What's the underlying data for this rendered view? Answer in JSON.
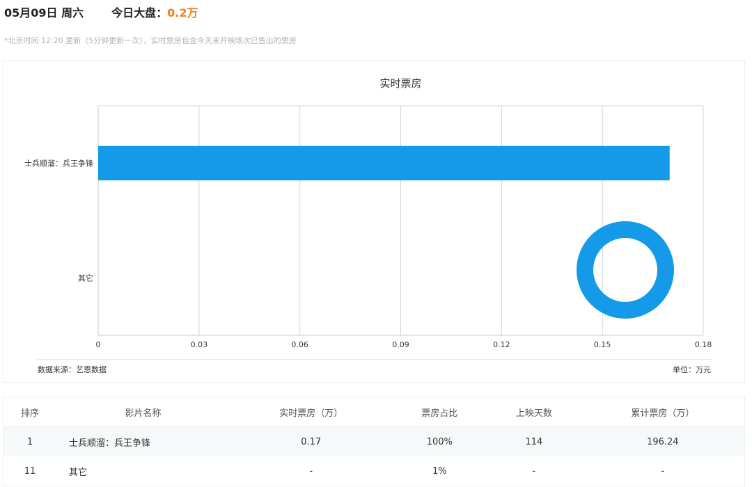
{
  "header": {
    "date": "05月09日 周六",
    "kpi_label": "今日大盘：",
    "kpi_value": "0.2万"
  },
  "note": "*北京时间 12:20 更新（5分钟更新一次），实时票房包含今天未开映场次已售出的票房",
  "chart_data": {
    "type": "bar",
    "orientation": "horizontal",
    "title": "实时票房",
    "categories": [
      "士兵顺溜：兵王争锋",
      "其它"
    ],
    "values": [
      0.17,
      0
    ],
    "xlim": [
      0,
      0.18
    ],
    "x_ticks": [
      "0",
      "0.03",
      "0.06",
      "0.09",
      "0.12",
      "0.15",
      "0.18"
    ],
    "grid": true,
    "bar_color": "#149ae9"
  },
  "footer": {
    "source": "数据来源：艺恩数据",
    "unit": "单位：万元"
  },
  "table": {
    "headers": [
      "排序",
      "影片名称",
      "实时票房（万）",
      "票房占比",
      "上映天数",
      "累计票房（万）"
    ],
    "rows": [
      {
        "rank": "1",
        "name": "士兵顺溜：兵王争锋",
        "realtime": "0.17",
        "share": "100%",
        "days": "114",
        "total": "196.24"
      },
      {
        "rank": "11",
        "name": "其它",
        "realtime": "-",
        "share": "1%",
        "days": "-",
        "total": "-"
      }
    ]
  }
}
